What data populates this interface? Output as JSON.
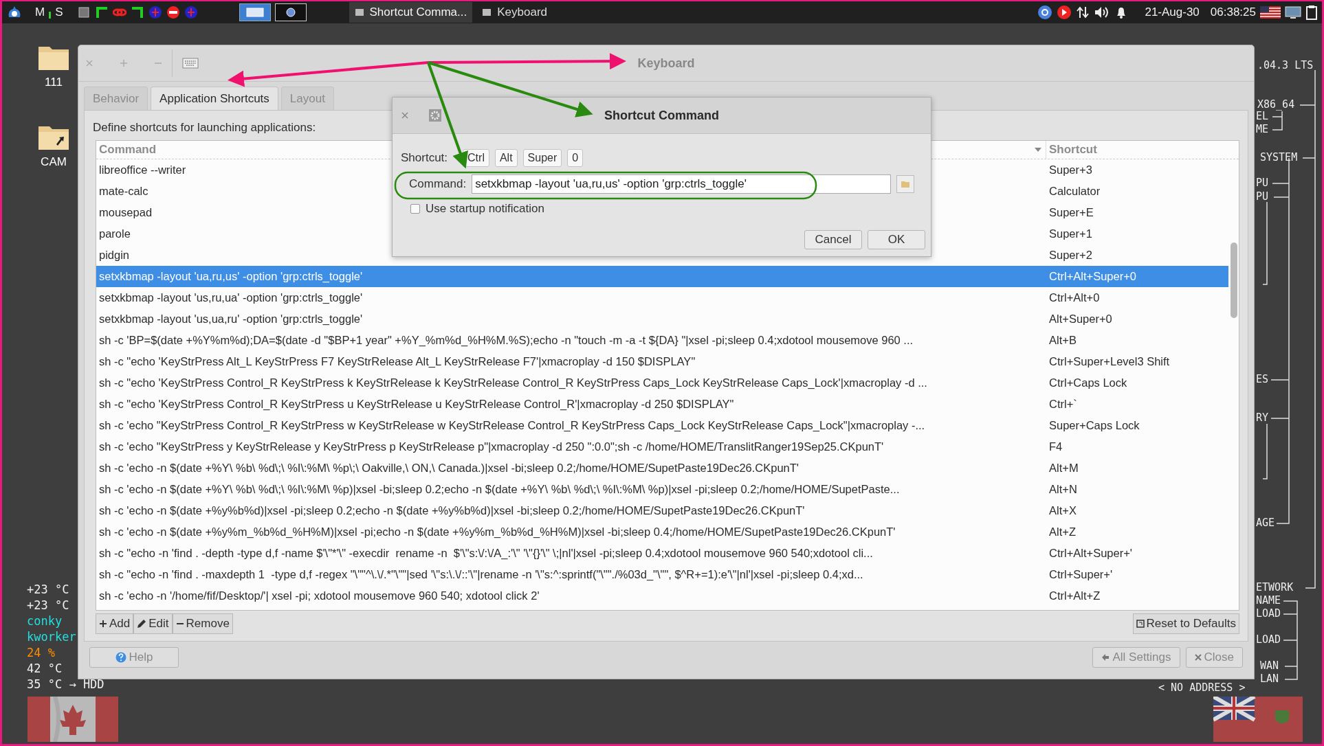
{
  "taskbar": {
    "workspaces": [
      "M",
      "S"
    ],
    "tasks": [
      {
        "label": "Shortcut Comma...",
        "selected": true
      },
      {
        "label": "Keyboard",
        "selected": false
      }
    ],
    "date": "21-Aug-30",
    "time": "06:38:25"
  },
  "desktop_icons": [
    {
      "label": "111",
      "kind": "folder"
    },
    {
      "label": "CAM",
      "kind": "link"
    }
  ],
  "conky_left": [
    {
      "text": "+23 °C",
      "color": "#f0f0f0"
    },
    {
      "text": "+23 °C",
      "color": "#f0f0f0"
    },
    {
      "text": "conky",
      "color": "#22e0e0"
    },
    {
      "text": "kworker",
      "color": "#22e0e0"
    },
    {
      "text": "24 %",
      "color": "#ff8c00"
    },
    {
      "text": "42 °C",
      "color": "#f0f0f0"
    },
    {
      "text": "35 °C →  HDD",
      "color": "#f0f0f0"
    }
  ],
  "conky_right": [
    ".04.3 LTS",
    "X86_64",
    "EL",
    "ME",
    "SYSTEM",
    "PU",
    "PU",
    "ES",
    "RY",
    "AGE",
    "ETWORK",
    "NAME",
    "LOAD",
    "LOAD",
    "WAN",
    "LAN",
    "< NO ADDRESS >"
  ],
  "window": {
    "title": "Keyboard",
    "tabs": [
      {
        "label": "Behavior",
        "selected": false
      },
      {
        "label": "Application Shortcuts",
        "selected": true
      },
      {
        "label": "Layout",
        "selected": false
      }
    ],
    "description": "Define shortcuts for launching applications:",
    "table": {
      "columns": [
        "Command",
        "Shortcut"
      ],
      "rows": [
        {
          "command": "libreoffice --writer",
          "shortcut": "Super+3",
          "selected": false
        },
        {
          "command": "mate-calc",
          "shortcut": "Calculator",
          "selected": false
        },
        {
          "command": "mousepad",
          "shortcut": "Super+E",
          "selected": false
        },
        {
          "command": "parole",
          "shortcut": "Super+1",
          "selected": false
        },
        {
          "command": "pidgin",
          "shortcut": "Super+2",
          "selected": false
        },
        {
          "command": "setxkbmap -layout 'ua,ru,us' -option 'grp:ctrls_toggle'",
          "shortcut": "Ctrl+Alt+Super+0",
          "selected": true
        },
        {
          "command": "setxkbmap -layout 'us,ru,ua' -option 'grp:ctrls_toggle'",
          "shortcut": "Ctrl+Alt+0",
          "selected": false
        },
        {
          "command": "setxkbmap -layout 'us,ua,ru' -option 'grp:ctrls_toggle'",
          "shortcut": "Alt+Super+0",
          "selected": false
        },
        {
          "command": "sh -c 'BP=$(date +%Y%m%d);DA=$(date -d \"$BP+1 year\" +%Y_%m%d_%H%M.%S);echo -n \"touch -m -a -t ${DA} \"|xsel -pi;sleep 0.4;xdotool mousemove 960 ...",
          "shortcut": "Alt+B",
          "selected": false
        },
        {
          "command": "sh -c \"echo 'KeyStrPress Alt_L KeyStrPress F7 KeyStrRelease Alt_L KeyStrRelease F7'|xmacroplay -d 150 $DISPLAY\"",
          "shortcut": "Ctrl+Super+Level3 Shift",
          "selected": false
        },
        {
          "command": "sh -c \"echo 'KeyStrPress Control_R KeyStrPress k KeyStrRelease k KeyStrRelease Control_R KeyStrPress Caps_Lock KeyStrRelease Caps_Lock'|xmacroplay -d ...",
          "shortcut": "Ctrl+Caps Lock",
          "selected": false
        },
        {
          "command": "sh -c \"echo 'KeyStrPress Control_R KeyStrPress u KeyStrRelease u KeyStrRelease Control_R'|xmacroplay -d 250 $DISPLAY\"",
          "shortcut": "Ctrl+`",
          "selected": false
        },
        {
          "command": "sh -c 'echo \"KeyStrPress Control_R KeyStrPress w KeyStrRelease w KeyStrRelease Control_R KeyStrPress Caps_Lock KeyStrRelease Caps_Lock\"|xmacroplay -...",
          "shortcut": "Super+Caps Lock",
          "selected": false
        },
        {
          "command": "sh -c 'echo \"KeyStrPress y KeyStrRelease y KeyStrPress p KeyStrRelease p\"|xmacroplay -d 250 \":0.0\";sh -c /home/HOME/TranslitRanger19Sep25.CKpunT'",
          "shortcut": "F4",
          "selected": false
        },
        {
          "command": "sh -c 'echo -n $(date +%Y\\ %b\\ %d\\;\\ %I\\:%M\\ %p\\;\\ Oakville,\\ ON,\\ Canada.)|xsel -bi;sleep 0.2;/home/HOME/SupetPaste19Dec26.CKpunT'",
          "shortcut": "Alt+M",
          "selected": false
        },
        {
          "command": "sh -c 'echo -n $(date +%Y\\ %b\\ %d\\;\\ %I\\:%M\\ %p)|xsel -bi;sleep 0.2;echo -n $(date +%Y\\ %b\\ %d\\;\\ %I\\:%M\\ %p)|xsel -pi;sleep 0.2;/home/HOME/SupetPaste...",
          "shortcut": "Alt+N",
          "selected": false
        },
        {
          "command": "sh -c 'echo -n $(date +%y%b%d)|xsel -pi;sleep 0.2;echo -n $(date +%y%b%d)|xsel -bi;sleep 0.2;/home/HOME/SupetPaste19Dec26.CKpunT'",
          "shortcut": "Alt+X",
          "selected": false
        },
        {
          "command": "sh -c 'echo -n $(date +%y%m_%b%d_%H%M)|xsel -pi;echo -n $(date +%y%m_%b%d_%H%M)|xsel -bi;sleep 0.4;/home/HOME/SupetPaste19Dec26.CKpunT'",
          "shortcut": "Alt+Z",
          "selected": false
        },
        {
          "command": "sh -c \"echo -n 'find . -depth -type d,f -name $'\\\"*'\\\" -execdir  rename -n  $'\\\"s:\\/:\\/A_:'\\\" '\\\"{}'\\\" \\;|nl'|xsel -pi;sleep 0.4;xdotool mousemove 960 540;xdotool cli...",
          "shortcut": "Ctrl+Alt+Super+'",
          "selected": false
        },
        {
          "command": "sh -c \"echo -n 'find . -maxdepth 1  -type d,f -regex \"\\\"\"^\\.\\/.*\"\\\"\"|sed '\\\"s:\\.\\/::'\\\"|rename -n '\\\"s:^:sprintf(\"\\\"\"./%03d_\"\\\"\", $^R+=1):e'\\\"|nl'|xsel -pi;sleep 0.4;xd...",
          "shortcut": "Ctrl+Super+'",
          "selected": false
        },
        {
          "command": "sh -c 'echo -n '/home/fif/Desktop/'| xsel -pi; xdotool mousemove 960 540; xdotool click 2'",
          "shortcut": "Ctrl+Alt+Z",
          "selected": false
        }
      ]
    },
    "toolbar": [
      {
        "label": "Add",
        "kind": "add"
      },
      {
        "label": "Edit",
        "kind": "edit"
      },
      {
        "label": "Remove",
        "kind": "remove"
      }
    ],
    "reset_button": "Reset to Defaults",
    "help_button": "Help",
    "footer_buttons": [
      {
        "label": "All Settings",
        "kind": "back"
      },
      {
        "label": "Close",
        "kind": "close"
      }
    ]
  },
  "dialog": {
    "title": "Shortcut Command",
    "shortcut_label": "Shortcut:",
    "keys": [
      "Ctrl",
      "Alt",
      "Super",
      "0"
    ],
    "command_label": "Command:",
    "command_value": "setxkbmap -layout 'ua,ru,us' -option 'grp:ctrls_toggle'",
    "startup_notification": {
      "label": "Use startup notification",
      "checked": false
    },
    "buttons": [
      "Cancel",
      "OK"
    ]
  }
}
